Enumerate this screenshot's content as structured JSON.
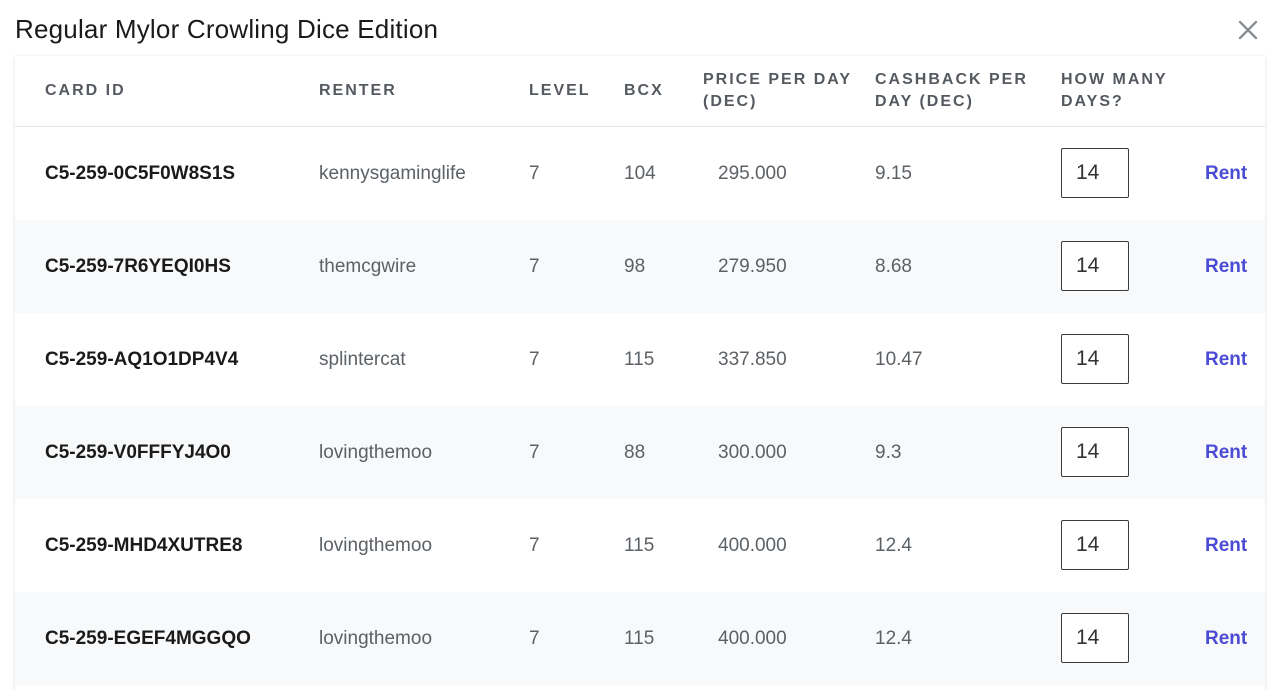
{
  "title": "Regular Mylor Crowling Dice Edition",
  "close_icon": "close-icon",
  "colors": {
    "accent": "#4b4bd6",
    "row_alt": "#f8f9fa",
    "header_text": "#555a60"
  },
  "columns": {
    "card_id": "CARD ID",
    "renter": "RENTER",
    "level": "LEVEL",
    "bcx": "BCX",
    "price_line1": "PRICE PER DAY",
    "price_line2": "(DEC)",
    "cashback_line1": "CASHBACK PER",
    "cashback_line2": "DAY (DEC)",
    "days_line1": "HOW MANY",
    "days_line2": "DAYS?"
  },
  "rows": [
    {
      "card_id": "C5-259-0C5F0W8S1S",
      "renter": "kennysgaminglife",
      "level": "7",
      "bcx": "104",
      "price": "295.000",
      "cashback": "9.15",
      "days": "14",
      "action": "Rent"
    },
    {
      "card_id": "C5-259-7R6YEQI0HS",
      "renter": "themcgwire",
      "level": "7",
      "bcx": "98",
      "price": "279.950",
      "cashback": "8.68",
      "days": "14",
      "action": "Rent"
    },
    {
      "card_id": "C5-259-AQ1O1DP4V4",
      "renter": "splintercat",
      "level": "7",
      "bcx": "115",
      "price": "337.850",
      "cashback": "10.47",
      "days": "14",
      "action": "Rent"
    },
    {
      "card_id": "C5-259-V0FFFYJ4O0",
      "renter": "lovingthemoo",
      "level": "7",
      "bcx": "88",
      "price": "300.000",
      "cashback": "9.3",
      "days": "14",
      "action": "Rent"
    },
    {
      "card_id": "C5-259-MHD4XUTRE8",
      "renter": "lovingthemoo",
      "level": "7",
      "bcx": "115",
      "price": "400.000",
      "cashback": "12.4",
      "days": "14",
      "action": "Rent"
    },
    {
      "card_id": "C5-259-EGEF4MGGQO",
      "renter": "lovingthemoo",
      "level": "7",
      "bcx": "115",
      "price": "400.000",
      "cashback": "12.4",
      "days": "14",
      "action": "Rent"
    }
  ]
}
